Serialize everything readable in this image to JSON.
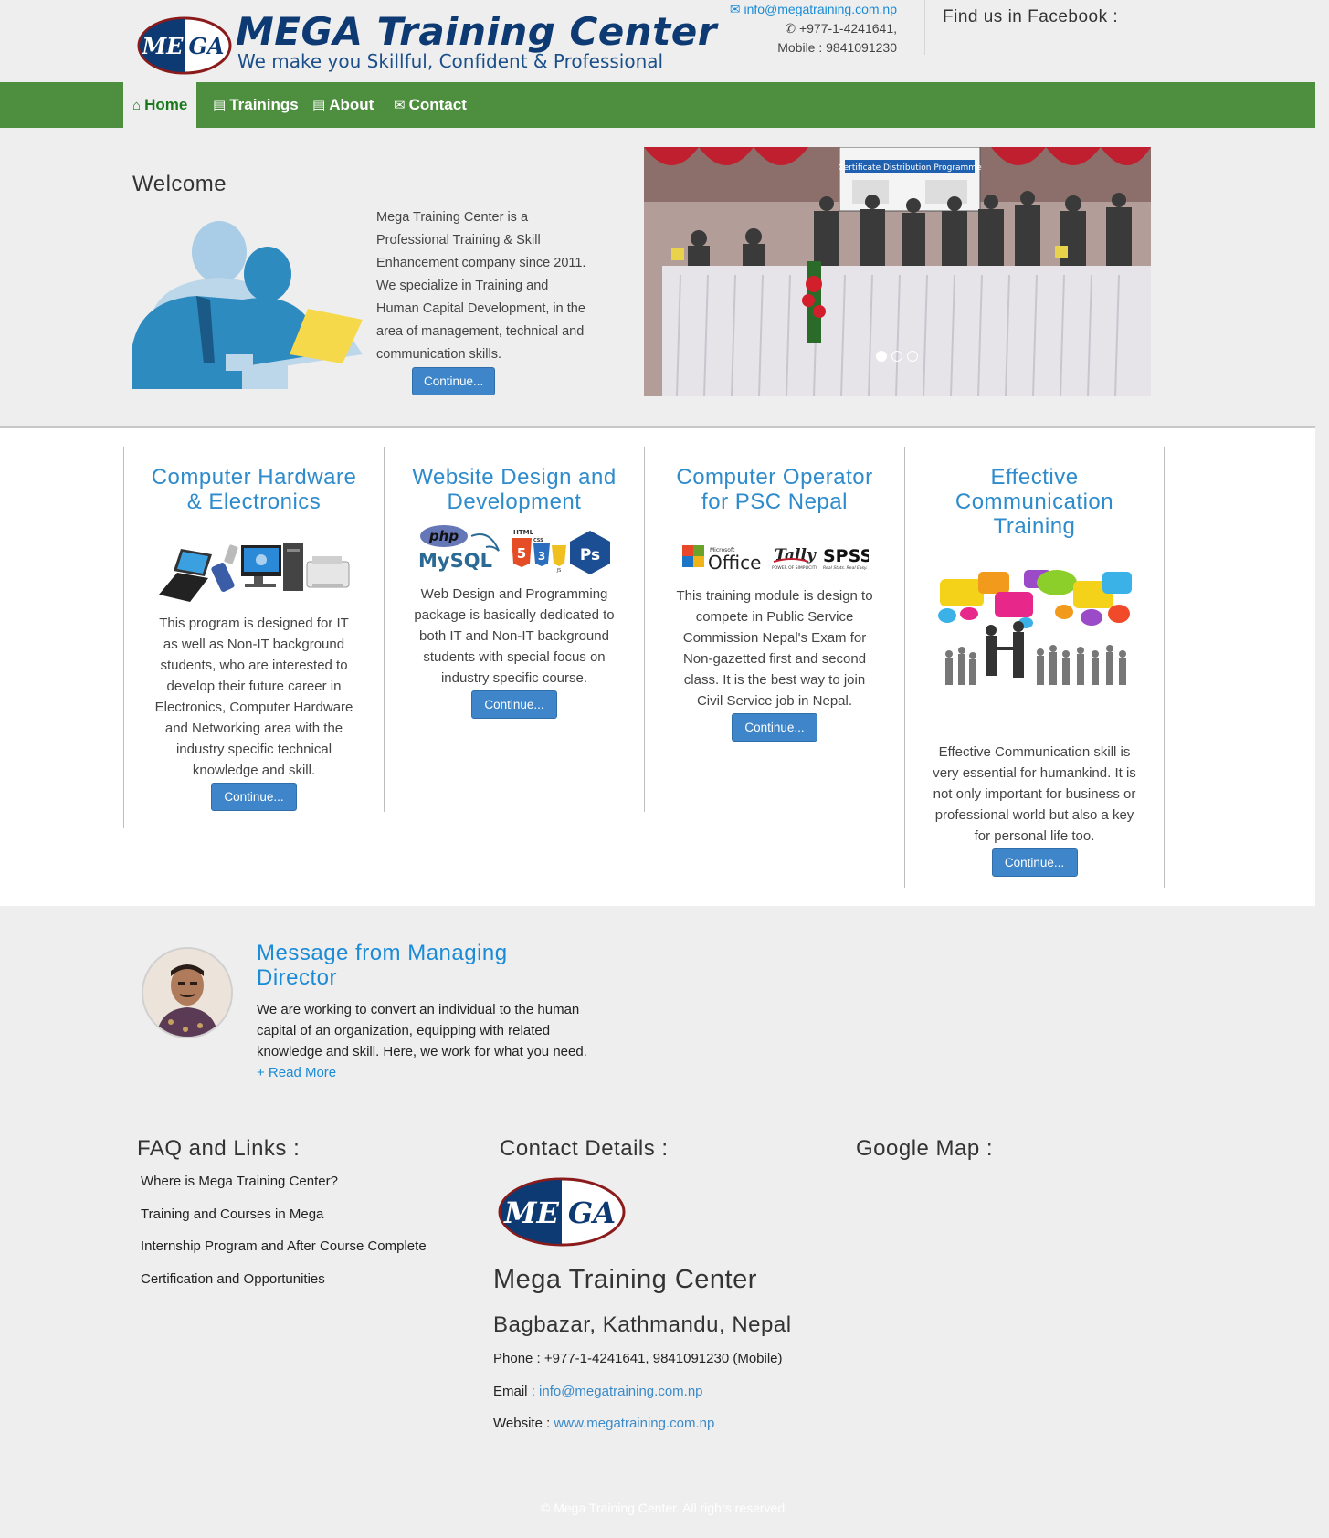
{
  "header": {
    "brand_title": "MEGA Training Center",
    "brand_tagline": "We make you Skillful, Confident & Professional",
    "logo_left": "ME",
    "logo_right": "GA",
    "email": "info@megatraining.com.np",
    "phone": "+977-1-4241641,",
    "mobile": "Mobile : 9841091230",
    "facebook_label": "Find us in Facebook :"
  },
  "nav": [
    {
      "label": "Home",
      "icon": "home-icon"
    },
    {
      "label": "Trainings",
      "icon": "book-icon"
    },
    {
      "label": "About",
      "icon": "book-icon"
    },
    {
      "label": "Contact",
      "icon": "envelope-icon"
    }
  ],
  "welcome": {
    "title": "Welcome",
    "text": "Mega Training Center is a Professional Training & Skill Enhancement company since 2011. We specialize in Training and Human Capital Development, in the area of management, technical and communication skills.",
    "button": "Continue..."
  },
  "slider": {
    "banner_text": "Certificate Distribution Programme",
    "slides": 3,
    "active": 1
  },
  "courses": [
    {
      "title": "Computer Hardware & Electronics",
      "desc": "This program is designed for IT as well as Non-IT background students, who are interested to develop their future career in Electronics, Computer Hardware and Networking area with the industry specific technical knowledge and skill.",
      "button": "Continue..."
    },
    {
      "title": "Website Design and Development",
      "desc": "Web Design and Programming package is basically dedicated to both IT and Non-IT background students with special focus on industry specific course.",
      "button": "Continue..."
    },
    {
      "title": "Computer Operator for PSC Nepal",
      "desc": "This training module is design to compete in Public Service Commission Nepal's Exam for Non-gazetted first and second class. It is the best way to join Civil Service job in Nepal.",
      "button": "Continue..."
    },
    {
      "title": "Effective Communication Training",
      "desc": "Effective Communication skill is very essential for humankind. It is not only important for business or professional world but also a key for personal life too.",
      "button": "Continue..."
    }
  ],
  "course_logos": {
    "php": "php",
    "mysql": "MySQL",
    "html": "HTML",
    "css": "CSS",
    "js": "JS",
    "ps": "Ps",
    "office_small": "Microsoft",
    "office": "Office",
    "tally": "Tally",
    "tally_sub": "POWER OF SIMPLICITY",
    "spss": "SPSS",
    "spss_sub": "Real Stats. Real Easy."
  },
  "md": {
    "title": "Message from Managing Director",
    "text": "We are working to convert an individual to the human capital of an organization, equipping with related knowledge and skill. Here, we work for what you need.",
    "read_more": "+ Read More"
  },
  "footer": {
    "faq_title": "FAQ and Links :",
    "faq_links": [
      "Where is Mega Training Center?",
      "Training and Courses in Mega",
      "Internship Program and After Course Complete",
      "Certification and Opportunities"
    ],
    "contact_title": "Contact Details :",
    "company": "Mega Training Center",
    "address": "Bagbazar, Kathmandu, Nepal",
    "phone_label": "Phone :",
    "phone": "+977-1-4241641, 9841091230 (Mobile)",
    "email_label": "Email :",
    "email": "info@megatraining.com.np",
    "website_label": "Website :",
    "website": "www.megatraining.com.np",
    "map_title": "Google Map :",
    "copyright": "© Mega Training Center. All rights reserved."
  },
  "colors": {
    "nav_green": "#4e8f3f",
    "brand_navy": "#0e3a73",
    "link_blue": "#1a8bd6",
    "button_blue": "#3e86c9"
  }
}
